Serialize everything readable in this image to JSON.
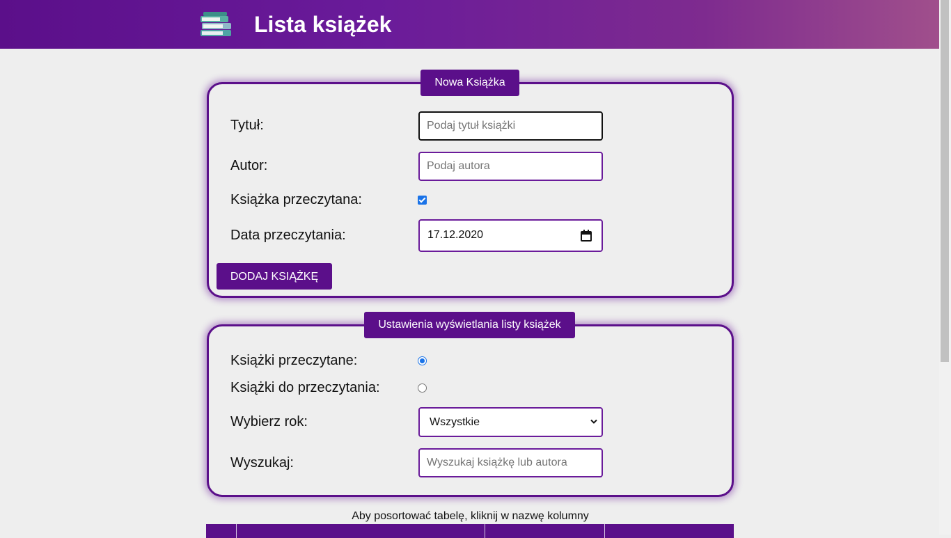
{
  "header": {
    "title": "Lista książek",
    "logo_icon": "books-stack-icon",
    "gradient": [
      "#5b0f8a",
      "#a04f8c"
    ]
  },
  "new_book": {
    "legend": "Nowa Książka",
    "title_label": "Tytuł:",
    "title_placeholder": "Podaj tytuł książki",
    "author_label": "Autor:",
    "author_placeholder": "Podaj autora",
    "read_label": "Książka przeczytana:",
    "read_checked": true,
    "date_label": "Data przeczytania:",
    "date_value": "17.12.2020",
    "add_button": "DODAJ KSIĄŻKĘ"
  },
  "settings": {
    "legend": "Ustawienia wyświetlania listy książek",
    "read_books_label": "Książki przeczytane:",
    "read_books_selected": true,
    "to_read_label": "Książki do przeczytania:",
    "to_read_selected": false,
    "year_label": "Wybierz rok:",
    "year_value": "Wszystkie",
    "search_label": "Wyszukaj:",
    "search_placeholder": "Wyszukaj książkę lub autora"
  },
  "table": {
    "sort_hint": "Aby posortować tabelę, kliknij w nazwę kolumny"
  },
  "colors": {
    "accent": "#5b0f8a",
    "input_border": "#6a1b9a",
    "background": "#eeeeee",
    "control_blue": "#1a73e8"
  }
}
